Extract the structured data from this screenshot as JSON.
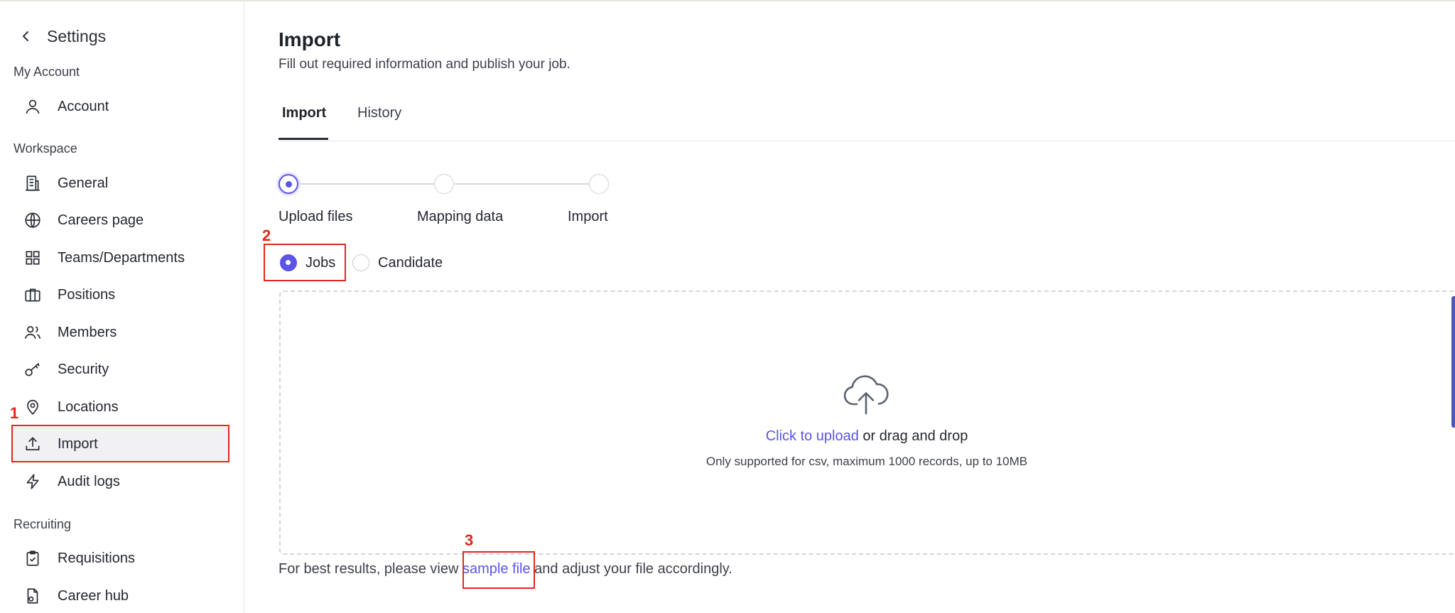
{
  "sidebar": {
    "back_title": "Settings",
    "sections": {
      "my_account": "My Account",
      "workspace": "Workspace",
      "recruiting": "Recruiting"
    },
    "items": {
      "account": "Account",
      "general": "General",
      "careers_page": "Careers page",
      "teams": "Teams/Departments",
      "positions": "Positions",
      "members": "Members",
      "security": "Security",
      "locations": "Locations",
      "import": "Import",
      "audit_logs": "Audit logs",
      "requisitions": "Requisitions",
      "career_hub": "Career hub"
    },
    "active_item": "Import"
  },
  "header": {
    "title": "Import",
    "subtitle": "Fill out required information and publish your job."
  },
  "tabs": [
    "Import",
    "History"
  ],
  "active_tab": "Import",
  "steps": [
    "Upload files",
    "Mapping data",
    "Import"
  ],
  "current_step": "Upload files",
  "import_type": {
    "options": [
      "Jobs",
      "Candidate"
    ],
    "selected": "Jobs"
  },
  "dropzone": {
    "link_text": "Click to upload",
    "rest_text": " or drag and drop",
    "hint": "Only supported for csv, maximum 1000 records, up to 10MB"
  },
  "footnote": {
    "before": "For best results, please view ",
    "link": "sample file",
    "after": " and adjust your file accordingly."
  },
  "annotations": [
    "1",
    "2",
    "3"
  ],
  "colors": {
    "accent": "#5b54e6",
    "annotation": "#e0281b",
    "active_nav_bg": "#f1f1f3"
  }
}
